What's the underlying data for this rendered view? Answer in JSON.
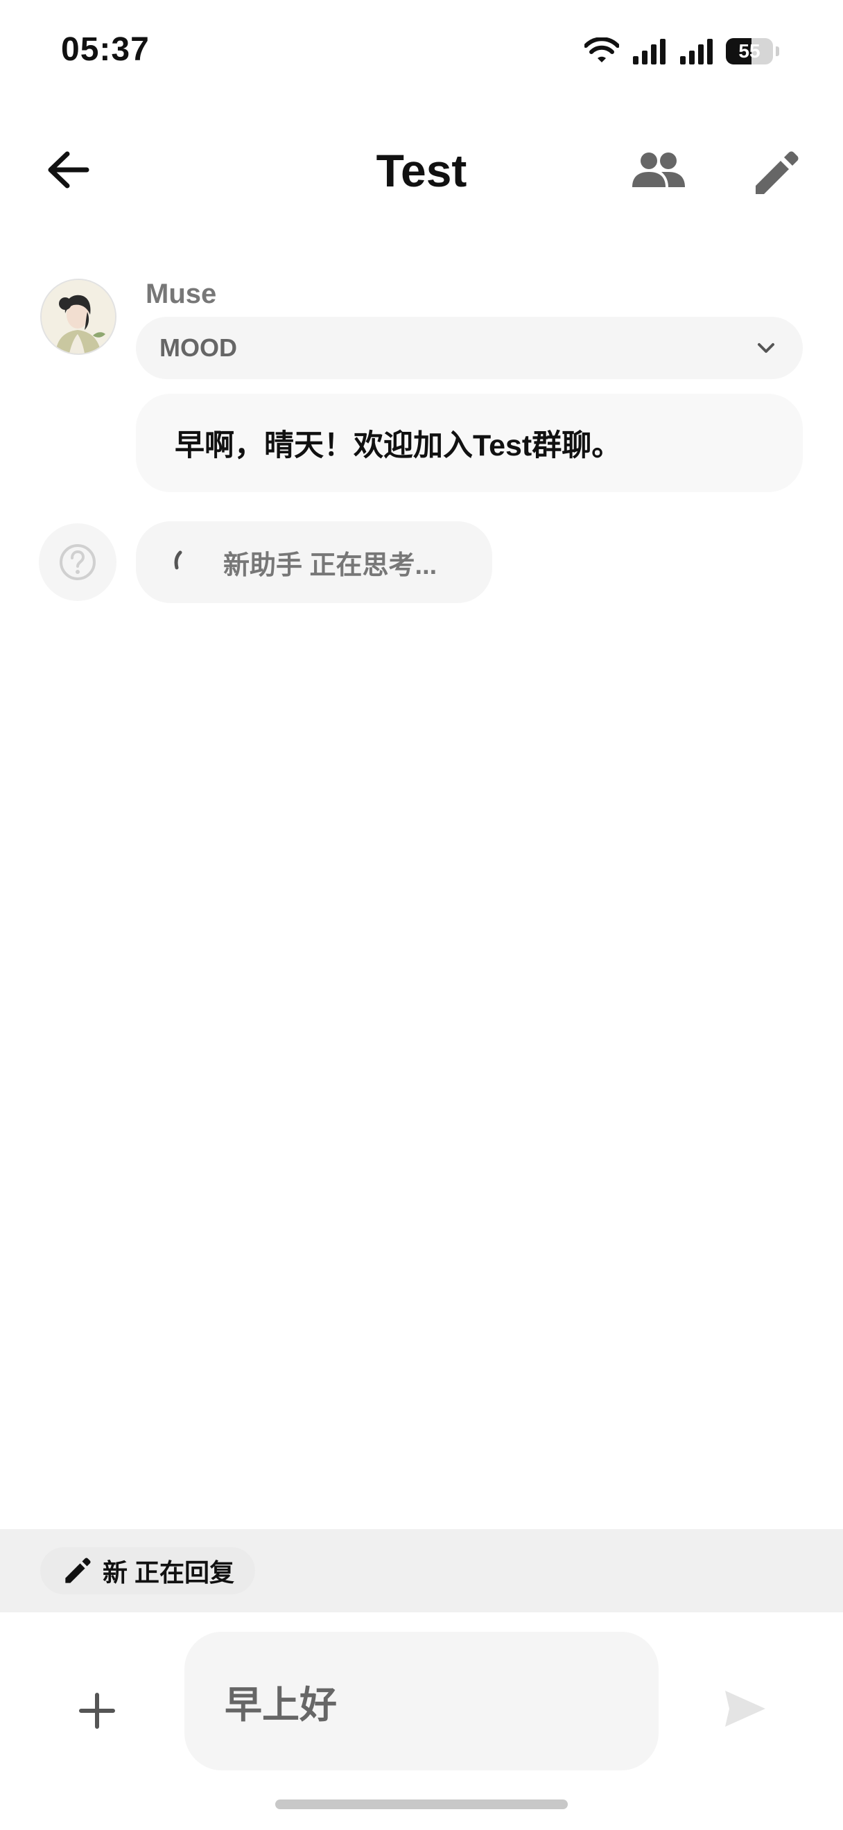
{
  "status_bar": {
    "time": "05:37",
    "battery_level": "55"
  },
  "header": {
    "title": "Test",
    "back_icon": "arrow-left-icon",
    "members_icon": "group-icon",
    "edit_icon": "pencil-icon"
  },
  "messages": [
    {
      "sender": "Muse",
      "avatar": "muse-avatar-illustration",
      "mood_label": "MOOD",
      "text": "早啊，晴天！欢迎加入Test群聊。"
    }
  ],
  "thinking": {
    "icon": "question-circle-icon",
    "text": "新助手 正在思考..."
  },
  "reply_status": {
    "icon": "pencil-icon",
    "text": "新 正在回复"
  },
  "composer": {
    "value": "早上好",
    "add_icon": "plus-icon",
    "send_icon": "send-icon"
  },
  "colors": {
    "background": "#ffffff",
    "bubble": "#f8f8f8",
    "reply_bar": "#f0f0f0",
    "icon_gray": "#666666"
  }
}
